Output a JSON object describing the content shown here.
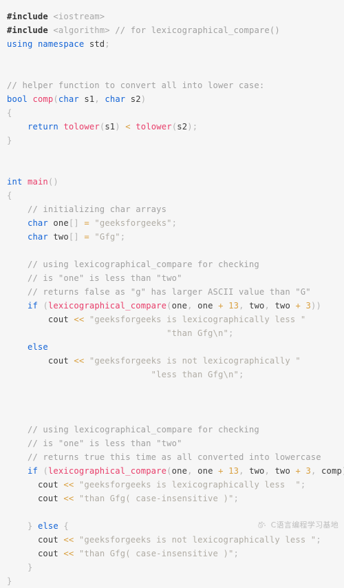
{
  "editor": {
    "background_color": "#f6f6f6",
    "language": "C++",
    "colors": {
      "keyword": "#1464d6",
      "function": "#e83e6a",
      "comment": "#a0a0a0",
      "string": "#b0aca4",
      "number": "#d9a040",
      "operator": "#d9a040",
      "punctuation": "#b5b5b5",
      "identifier": "#3c3c3c",
      "preprocessor": "#333333",
      "header": "#a8a8a8"
    }
  },
  "code": {
    "lines": [
      {
        "n": 1,
        "tokens": [
          {
            "t": "pre",
            "v": "#include"
          },
          {
            "t": "plain",
            "v": " "
          },
          {
            "t": "header",
            "v": "<iostream>"
          }
        ]
      },
      {
        "n": 2,
        "tokens": [
          {
            "t": "pre",
            "v": "#include"
          },
          {
            "t": "plain",
            "v": " "
          },
          {
            "t": "header",
            "v": "<algorithm>"
          },
          {
            "t": "plain",
            "v": " "
          },
          {
            "t": "comment",
            "v": "// for lexicographical_compare()"
          }
        ]
      },
      {
        "n": 3,
        "tokens": [
          {
            "t": "kw",
            "v": "using"
          },
          {
            "t": "plain",
            "v": " "
          },
          {
            "t": "kw",
            "v": "namespace"
          },
          {
            "t": "plain",
            "v": " "
          },
          {
            "t": "id",
            "v": "std"
          },
          {
            "t": "punct",
            "v": ";"
          }
        ]
      },
      {
        "n": 4,
        "tokens": []
      },
      {
        "n": 5,
        "tokens": []
      },
      {
        "n": 6,
        "tokens": [
          {
            "t": "comment",
            "v": "// helper function to convert all into lower case:"
          }
        ]
      },
      {
        "n": 7,
        "tokens": [
          {
            "t": "kw",
            "v": "bool"
          },
          {
            "t": "plain",
            "v": " "
          },
          {
            "t": "fn",
            "v": "comp"
          },
          {
            "t": "punct",
            "v": "("
          },
          {
            "t": "kw",
            "v": "char"
          },
          {
            "t": "plain",
            "v": " "
          },
          {
            "t": "id",
            "v": "s1"
          },
          {
            "t": "punct",
            "v": ","
          },
          {
            "t": "plain",
            "v": " "
          },
          {
            "t": "kw",
            "v": "char"
          },
          {
            "t": "plain",
            "v": " "
          },
          {
            "t": "id",
            "v": "s2"
          },
          {
            "t": "punct",
            "v": ")"
          }
        ]
      },
      {
        "n": 8,
        "tokens": [
          {
            "t": "brace",
            "v": "{"
          }
        ]
      },
      {
        "n": 9,
        "tokens": [
          {
            "t": "plain",
            "v": "    "
          },
          {
            "t": "kw",
            "v": "return"
          },
          {
            "t": "plain",
            "v": " "
          },
          {
            "t": "fn",
            "v": "tolower"
          },
          {
            "t": "punct",
            "v": "("
          },
          {
            "t": "id",
            "v": "s1"
          },
          {
            "t": "punct",
            "v": ")"
          },
          {
            "t": "plain",
            "v": " "
          },
          {
            "t": "op",
            "v": "<"
          },
          {
            "t": "plain",
            "v": " "
          },
          {
            "t": "fn",
            "v": "tolower"
          },
          {
            "t": "punct",
            "v": "("
          },
          {
            "t": "id",
            "v": "s2"
          },
          {
            "t": "punct",
            "v": ");"
          }
        ]
      },
      {
        "n": 10,
        "tokens": [
          {
            "t": "brace",
            "v": "}"
          }
        ]
      },
      {
        "n": 11,
        "tokens": []
      },
      {
        "n": 12,
        "tokens": []
      },
      {
        "n": 13,
        "tokens": [
          {
            "t": "kw",
            "v": "int"
          },
          {
            "t": "plain",
            "v": " "
          },
          {
            "t": "fn",
            "v": "main"
          },
          {
            "t": "punct",
            "v": "()"
          }
        ]
      },
      {
        "n": 14,
        "tokens": [
          {
            "t": "brace",
            "v": "{"
          }
        ]
      },
      {
        "n": 15,
        "tokens": [
          {
            "t": "plain",
            "v": "    "
          },
          {
            "t": "comment",
            "v": "// initializing char arrays"
          }
        ]
      },
      {
        "n": 16,
        "tokens": [
          {
            "t": "plain",
            "v": "    "
          },
          {
            "t": "kw",
            "v": "char"
          },
          {
            "t": "plain",
            "v": " "
          },
          {
            "t": "id",
            "v": "one"
          },
          {
            "t": "punct",
            "v": "[]"
          },
          {
            "t": "plain",
            "v": " "
          },
          {
            "t": "op",
            "v": "="
          },
          {
            "t": "plain",
            "v": " "
          },
          {
            "t": "str",
            "v": "\"geeksforgeeks\""
          },
          {
            "t": "punct",
            "v": ";"
          }
        ]
      },
      {
        "n": 17,
        "tokens": [
          {
            "t": "plain",
            "v": "    "
          },
          {
            "t": "kw",
            "v": "char"
          },
          {
            "t": "plain",
            "v": " "
          },
          {
            "t": "id",
            "v": "two"
          },
          {
            "t": "punct",
            "v": "[]"
          },
          {
            "t": "plain",
            "v": " "
          },
          {
            "t": "op",
            "v": "="
          },
          {
            "t": "plain",
            "v": " "
          },
          {
            "t": "str",
            "v": "\"Gfg\""
          },
          {
            "t": "punct",
            "v": ";"
          }
        ]
      },
      {
        "n": 18,
        "tokens": []
      },
      {
        "n": 19,
        "tokens": [
          {
            "t": "plain",
            "v": "    "
          },
          {
            "t": "comment",
            "v": "// using lexicographical_compare for checking"
          }
        ]
      },
      {
        "n": 20,
        "tokens": [
          {
            "t": "plain",
            "v": "    "
          },
          {
            "t": "comment",
            "v": "// is \"one\" is less than \"two\""
          }
        ]
      },
      {
        "n": 21,
        "tokens": [
          {
            "t": "plain",
            "v": "    "
          },
          {
            "t": "comment",
            "v": "// returns false as \"g\" has larger ASCII value than \"G\""
          }
        ]
      },
      {
        "n": 22,
        "tokens": [
          {
            "t": "plain",
            "v": "    "
          },
          {
            "t": "kw",
            "v": "if"
          },
          {
            "t": "plain",
            "v": " "
          },
          {
            "t": "punct",
            "v": "("
          },
          {
            "t": "fn",
            "v": "lexicographical_compare"
          },
          {
            "t": "punct",
            "v": "("
          },
          {
            "t": "id",
            "v": "one"
          },
          {
            "t": "punct",
            "v": ","
          },
          {
            "t": "plain",
            "v": " "
          },
          {
            "t": "id",
            "v": "one"
          },
          {
            "t": "plain",
            "v": " "
          },
          {
            "t": "op",
            "v": "+"
          },
          {
            "t": "plain",
            "v": " "
          },
          {
            "t": "num",
            "v": "13"
          },
          {
            "t": "punct",
            "v": ","
          },
          {
            "t": "plain",
            "v": " "
          },
          {
            "t": "id",
            "v": "two"
          },
          {
            "t": "punct",
            "v": ","
          },
          {
            "t": "plain",
            "v": " "
          },
          {
            "t": "id",
            "v": "two"
          },
          {
            "t": "plain",
            "v": " "
          },
          {
            "t": "op",
            "v": "+"
          },
          {
            "t": "plain",
            "v": " "
          },
          {
            "t": "num",
            "v": "3"
          },
          {
            "t": "punct",
            "v": "))"
          }
        ]
      },
      {
        "n": 23,
        "tokens": [
          {
            "t": "plain",
            "v": "        "
          },
          {
            "t": "id",
            "v": "cout"
          },
          {
            "t": "plain",
            "v": " "
          },
          {
            "t": "op",
            "v": "<<"
          },
          {
            "t": "plain",
            "v": " "
          },
          {
            "t": "str",
            "v": "\"geeksforgeeks is lexicographically less \""
          }
        ]
      },
      {
        "n": 24,
        "tokens": [
          {
            "t": "plain",
            "v": "                               "
          },
          {
            "t": "str",
            "v": "\"than Gfg\\n\""
          },
          {
            "t": "punct",
            "v": ";"
          }
        ]
      },
      {
        "n": 25,
        "tokens": [
          {
            "t": "plain",
            "v": "    "
          },
          {
            "t": "kw",
            "v": "else"
          }
        ]
      },
      {
        "n": 26,
        "tokens": [
          {
            "t": "plain",
            "v": "        "
          },
          {
            "t": "id",
            "v": "cout"
          },
          {
            "t": "plain",
            "v": " "
          },
          {
            "t": "op",
            "v": "<<"
          },
          {
            "t": "plain",
            "v": " "
          },
          {
            "t": "str",
            "v": "\"geeksforgeeks is not lexicographically \""
          }
        ]
      },
      {
        "n": 27,
        "tokens": [
          {
            "t": "plain",
            "v": "                            "
          },
          {
            "t": "str",
            "v": "\"less than Gfg\\n\""
          },
          {
            "t": "punct",
            "v": ";"
          }
        ]
      },
      {
        "n": 28,
        "tokens": []
      },
      {
        "n": 29,
        "tokens": []
      },
      {
        "n": 30,
        "tokens": []
      },
      {
        "n": 31,
        "tokens": [
          {
            "t": "plain",
            "v": "    "
          },
          {
            "t": "comment",
            "v": "// using lexicographical_compare for checking"
          }
        ]
      },
      {
        "n": 32,
        "tokens": [
          {
            "t": "plain",
            "v": "    "
          },
          {
            "t": "comment",
            "v": "// is \"one\" is less than \"two\""
          }
        ]
      },
      {
        "n": 33,
        "tokens": [
          {
            "t": "plain",
            "v": "    "
          },
          {
            "t": "comment",
            "v": "// returns true this time as all converted into lowercase"
          }
        ]
      },
      {
        "n": 34,
        "tokens": [
          {
            "t": "plain",
            "v": "    "
          },
          {
            "t": "kw",
            "v": "if"
          },
          {
            "t": "plain",
            "v": " "
          },
          {
            "t": "punct",
            "v": "("
          },
          {
            "t": "fn",
            "v": "lexicographical_compare"
          },
          {
            "t": "punct",
            "v": "("
          },
          {
            "t": "id",
            "v": "one"
          },
          {
            "t": "punct",
            "v": ","
          },
          {
            "t": "plain",
            "v": " "
          },
          {
            "t": "id",
            "v": "one"
          },
          {
            "t": "plain",
            "v": " "
          },
          {
            "t": "op",
            "v": "+"
          },
          {
            "t": "plain",
            "v": " "
          },
          {
            "t": "num",
            "v": "13"
          },
          {
            "t": "punct",
            "v": ","
          },
          {
            "t": "plain",
            "v": " "
          },
          {
            "t": "id",
            "v": "two"
          },
          {
            "t": "punct",
            "v": ","
          },
          {
            "t": "plain",
            "v": " "
          },
          {
            "t": "id",
            "v": "two"
          },
          {
            "t": "plain",
            "v": " "
          },
          {
            "t": "op",
            "v": "+"
          },
          {
            "t": "plain",
            "v": " "
          },
          {
            "t": "num",
            "v": "3"
          },
          {
            "t": "punct",
            "v": ","
          },
          {
            "t": "plain",
            "v": " "
          },
          {
            "t": "id",
            "v": "comp"
          },
          {
            "t": "punct",
            "v": "))"
          },
          {
            "t": "plain",
            "v": " "
          },
          {
            "t": "brace",
            "v": "{"
          }
        ]
      },
      {
        "n": 35,
        "tokens": [
          {
            "t": "plain",
            "v": "      "
          },
          {
            "t": "id",
            "v": "cout"
          },
          {
            "t": "plain",
            "v": " "
          },
          {
            "t": "op",
            "v": "<<"
          },
          {
            "t": "plain",
            "v": " "
          },
          {
            "t": "str",
            "v": "\"geeksforgeeks is lexicographically less  \""
          },
          {
            "t": "punct",
            "v": ";"
          }
        ]
      },
      {
        "n": 36,
        "tokens": [
          {
            "t": "plain",
            "v": "      "
          },
          {
            "t": "id",
            "v": "cout"
          },
          {
            "t": "plain",
            "v": " "
          },
          {
            "t": "op",
            "v": "<<"
          },
          {
            "t": "plain",
            "v": " "
          },
          {
            "t": "str",
            "v": "\"than Gfg( case-insensitive )\""
          },
          {
            "t": "punct",
            "v": ";"
          }
        ]
      },
      {
        "n": 37,
        "tokens": []
      },
      {
        "n": 38,
        "tokens": [
          {
            "t": "plain",
            "v": "    "
          },
          {
            "t": "brace",
            "v": "}"
          },
          {
            "t": "plain",
            "v": " "
          },
          {
            "t": "kw",
            "v": "else"
          },
          {
            "t": "plain",
            "v": " "
          },
          {
            "t": "brace",
            "v": "{"
          }
        ]
      },
      {
        "n": 39,
        "tokens": [
          {
            "t": "plain",
            "v": "      "
          },
          {
            "t": "id",
            "v": "cout"
          },
          {
            "t": "plain",
            "v": " "
          },
          {
            "t": "op",
            "v": "<<"
          },
          {
            "t": "plain",
            "v": " "
          },
          {
            "t": "str",
            "v": "\"geeksforgeeks is not lexicographically less \""
          },
          {
            "t": "punct",
            "v": ";"
          }
        ]
      },
      {
        "n": 40,
        "tokens": [
          {
            "t": "plain",
            "v": "      "
          },
          {
            "t": "id",
            "v": "cout"
          },
          {
            "t": "plain",
            "v": " "
          },
          {
            "t": "op",
            "v": "<<"
          },
          {
            "t": "plain",
            "v": " "
          },
          {
            "t": "str",
            "v": "\"than Gfg( case-insensitive )\""
          },
          {
            "t": "punct",
            "v": ";"
          }
        ]
      },
      {
        "n": 41,
        "tokens": [
          {
            "t": "plain",
            "v": "    "
          },
          {
            "t": "brace",
            "v": "}"
          }
        ]
      },
      {
        "n": 42,
        "tokens": [
          {
            "t": "brace",
            "v": "}"
          }
        ]
      }
    ]
  },
  "watermark": {
    "text": "C语言编程学习基地",
    "icon": "paw-logo-icon",
    "color": "#9b9b9b"
  }
}
